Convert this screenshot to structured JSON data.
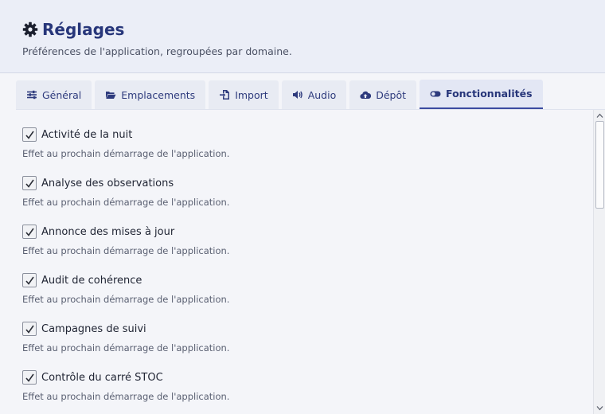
{
  "header": {
    "title": "Réglages",
    "subtitle": "Préférences de l'application, regroupées par domaine.",
    "icon": "gear-icon"
  },
  "tabs": [
    {
      "label": "Général",
      "icon": "sliders-icon",
      "active": false
    },
    {
      "label": "Emplacements",
      "icon": "folder-open-icon",
      "active": false
    },
    {
      "label": "Import",
      "icon": "file-import-icon",
      "active": false
    },
    {
      "label": "Audio",
      "icon": "volume-icon",
      "active": false
    },
    {
      "label": "Dépôt",
      "icon": "cloud-upload-icon",
      "active": false
    },
    {
      "label": "Fonctionnalités",
      "icon": "toggle-icon",
      "active": true
    }
  ],
  "options": [
    {
      "label": "Activité de la nuit",
      "checked": true,
      "description": "Effet au prochain démarrage de l'application."
    },
    {
      "label": "Analyse des observations",
      "checked": true,
      "description": "Effet au prochain démarrage de l'application."
    },
    {
      "label": "Annonce des mises à jour",
      "checked": true,
      "description": "Effet au prochain démarrage de l'application."
    },
    {
      "label": "Audit de cohérence",
      "checked": true,
      "description": "Effet au prochain démarrage de l'application."
    },
    {
      "label": "Campagnes de suivi",
      "checked": true,
      "description": "Effet au prochain démarrage de l'application."
    },
    {
      "label": "Contrôle du carré STOC",
      "checked": true,
      "description": "Effet au prochain démarrage de l'application."
    }
  ],
  "colors": {
    "accent": "#27367a",
    "tab_background": "#e8ebf3",
    "header_background": "#ebeef7",
    "page_background": "#f4f5f9"
  }
}
